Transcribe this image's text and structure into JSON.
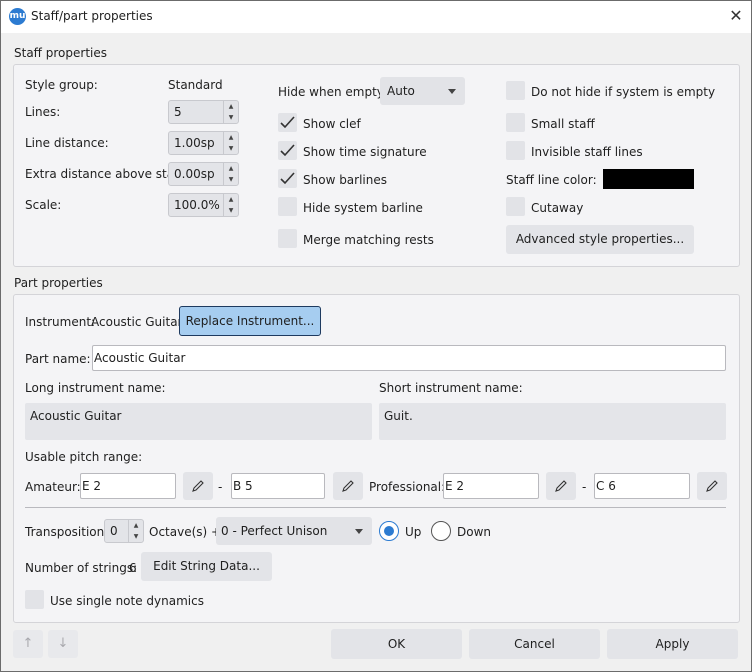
{
  "window": {
    "title": "Staff/part properties",
    "app_icon": "musescore-icon",
    "close_glyph": "✕"
  },
  "staff": {
    "section_title": "Staff properties",
    "style_group_label": "Style group:",
    "style_group_value": "Standard",
    "lines_label": "Lines:",
    "lines_value": "5",
    "line_distance_label": "Line distance:",
    "line_distance_value": "1.00sp",
    "extra_distance_label": "Extra distance above staff:",
    "extra_distance_value": "0.00sp",
    "scale_label": "Scale:",
    "scale_value": "100.0%",
    "hide_when_empty_label": "Hide when empty:",
    "hide_when_empty_value": "Auto",
    "show_clef": {
      "label": "Show clef",
      "checked": true
    },
    "show_time_signature": {
      "label": "Show time signature",
      "checked": true
    },
    "show_barlines": {
      "label": "Show barlines",
      "checked": true
    },
    "hide_system_barline": {
      "label": "Hide system barline",
      "checked": false
    },
    "merge_matching_rests": {
      "label": "Merge matching rests",
      "checked": false
    },
    "do_not_hide": {
      "label": "Do not hide if system is empty",
      "checked": false
    },
    "small_staff": {
      "label": "Small staff",
      "checked": false
    },
    "invisible_staff_lines": {
      "label": "Invisible staff lines",
      "checked": false
    },
    "staff_line_color_label": "Staff line color:",
    "staff_line_color": "#000000",
    "cutaway": {
      "label": "Cutaway",
      "checked": false
    },
    "advanced_button": "Advanced style properties..."
  },
  "part": {
    "section_title": "Part properties",
    "instrument_label": "Instrument:",
    "instrument_value": "Acoustic Guitar",
    "replace_button": "Replace Instrument...",
    "part_name_label": "Part name:",
    "part_name_value": "Acoustic Guitar",
    "long_name_label": "Long instrument name:",
    "long_name_value": "Acoustic Guitar",
    "short_name_label": "Short instrument name:",
    "short_name_value": "Guit.",
    "pitch_range_label": "Usable pitch range:",
    "amateur_label": "Amateur:",
    "amateur_low": "E 2",
    "amateur_high": "B 5",
    "professional_label": "Professional:",
    "professional_low": "E 2",
    "professional_high": "C 6",
    "range_dash": "-",
    "transposition_label": "Transposition:",
    "transposition_octaves": "0",
    "octaves_label": "Octave(s) +",
    "interval_value": "0 - Perfect Unison",
    "up_label": "Up",
    "down_label": "Down",
    "direction_selected": "Up",
    "strings_label": "Number of strings:",
    "strings_value": "6",
    "edit_strings_button": "Edit String Data...",
    "single_note_dynamics": {
      "label": "Use single note dynamics",
      "checked": false
    }
  },
  "footer": {
    "move_up_glyph": "↑",
    "move_down_glyph": "↓",
    "ok_button": "OK",
    "cancel_button": "Cancel",
    "apply_button": "Apply"
  },
  "colors": {
    "accent": "#2c7bd1",
    "replace_button_bg": "#a6cdf0",
    "button_bg": "#e3e4e8"
  }
}
